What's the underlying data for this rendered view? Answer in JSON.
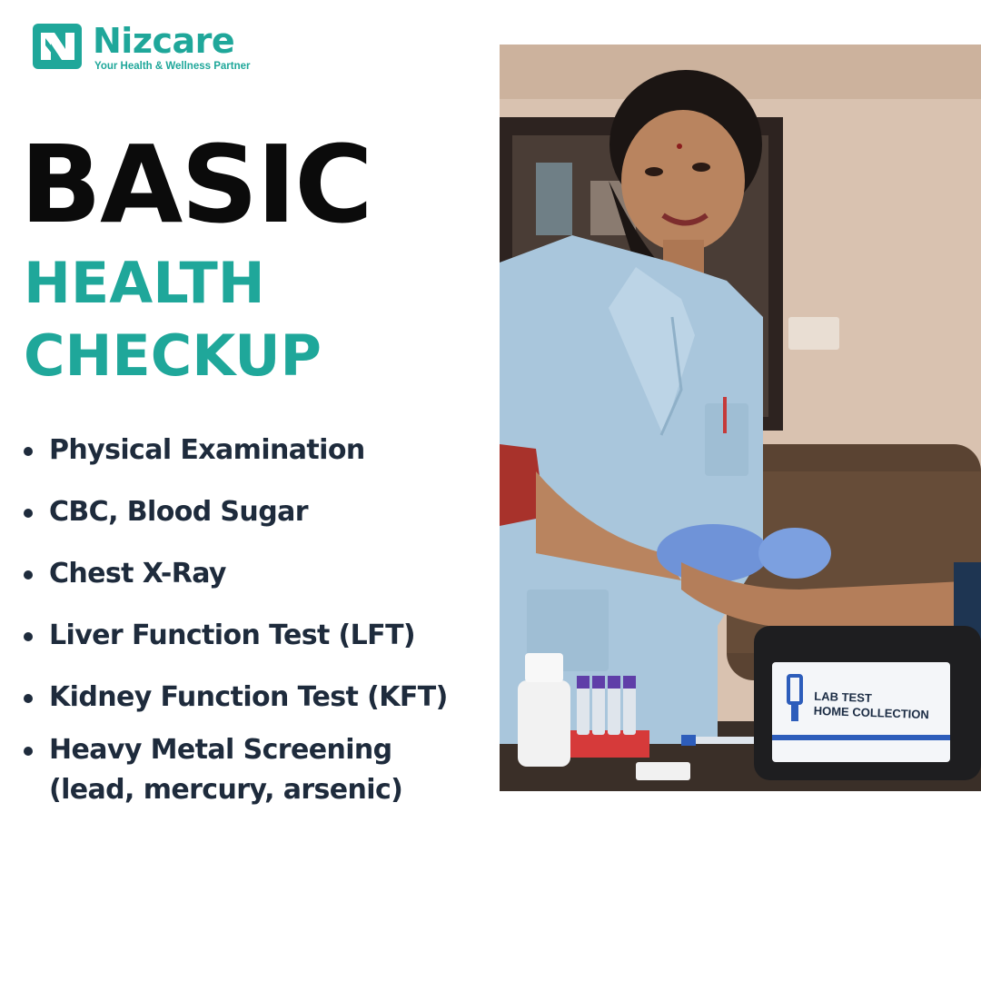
{
  "brand": {
    "name": "Nizcare",
    "tagline": "Your Health & Wellness Partner",
    "color": "#1fa79a"
  },
  "headline": {
    "line1": "BASIC",
    "line2": "HEALTH",
    "line3": "CHECKUP"
  },
  "tests": [
    "Physical Examination",
    "CBC, Blood Sugar",
    "Chest X-Ray",
    "Liver Function Test (LFT)",
    "Kidney Function Test (KFT)",
    "Heavy Metal Screening (lead, mercury, arsenic)"
  ],
  "photo": {
    "case_label_line1": "LAB TEST",
    "case_label_line2": "HOME COLLECTION"
  }
}
